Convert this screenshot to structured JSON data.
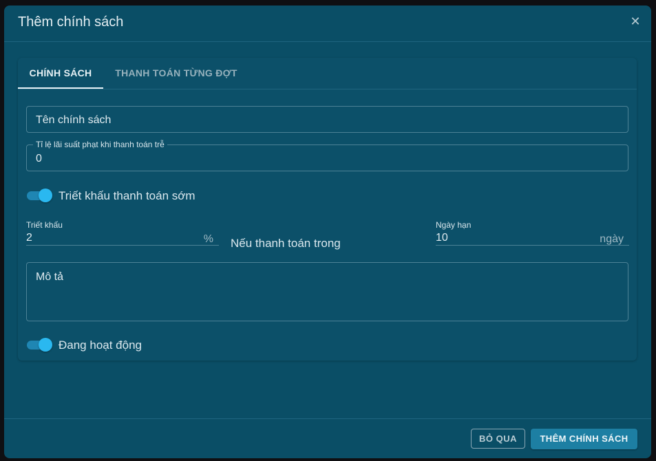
{
  "dialog": {
    "title": "Thêm chính sách",
    "close_icon": "close-icon"
  },
  "tabs": [
    {
      "label": "CHÍNH SÁCH",
      "active": true
    },
    {
      "label": "THANH TOÁN TỪNG ĐỢT",
      "active": false
    }
  ],
  "form": {
    "policy_name": {
      "placeholder": "Tên chính sách",
      "value": ""
    },
    "late_penalty_rate": {
      "label": "Tỉ lệ lãi suất phạt khi thanh toán trễ",
      "value": "0"
    },
    "early_payment_discount": {
      "label": "Triết khấu thanh toán sớm",
      "enabled": true
    },
    "discount": {
      "label": "Triết khấu",
      "value": "2",
      "suffix": "%"
    },
    "condition_text": "Nếu thanh toán trong",
    "due_days": {
      "label": "Ngày hạn",
      "value": "10",
      "suffix": "ngày"
    },
    "description": {
      "placeholder": "Mô tả",
      "value": ""
    },
    "active": {
      "label": "Đang hoạt động",
      "enabled": true
    }
  },
  "footer": {
    "cancel_label": "BỎ QUA",
    "submit_label": "THÊM CHÍNH SÁCH"
  },
  "colors": {
    "dialog_bg": "#0a4e66",
    "accent": "#2ab8f0",
    "primary_button": "#1d7fa3"
  }
}
